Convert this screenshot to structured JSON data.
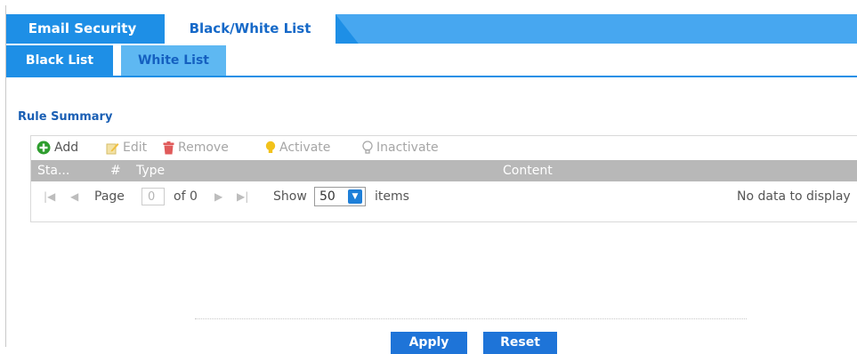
{
  "top_tabs": [
    {
      "label": "Email Security",
      "active": false
    },
    {
      "label": "Black/White List",
      "active": true
    }
  ],
  "sub_tabs": [
    {
      "label": "Black List",
      "active": true
    },
    {
      "label": "White List",
      "active": false
    }
  ],
  "section": {
    "title": "Rule Summary"
  },
  "toolbar": {
    "add": "Add",
    "edit": "Edit",
    "remove": "Remove",
    "activate": "Activate",
    "inactivate": "Inactivate"
  },
  "table": {
    "columns": [
      "Sta...",
      "#",
      "Type",
      "Content"
    ],
    "rows": []
  },
  "pager": {
    "page_label": "Page",
    "page_value": "0",
    "of_label": "of 0",
    "show_label": "Show",
    "page_size": "50",
    "items_label": "items",
    "empty_message": "No data to display"
  },
  "buttons": {
    "apply": "Apply",
    "reset": "Reset"
  },
  "colors": {
    "accent": "#1e8fe6",
    "button": "#1e74d8",
    "header_gray": "#b8b8b8"
  }
}
